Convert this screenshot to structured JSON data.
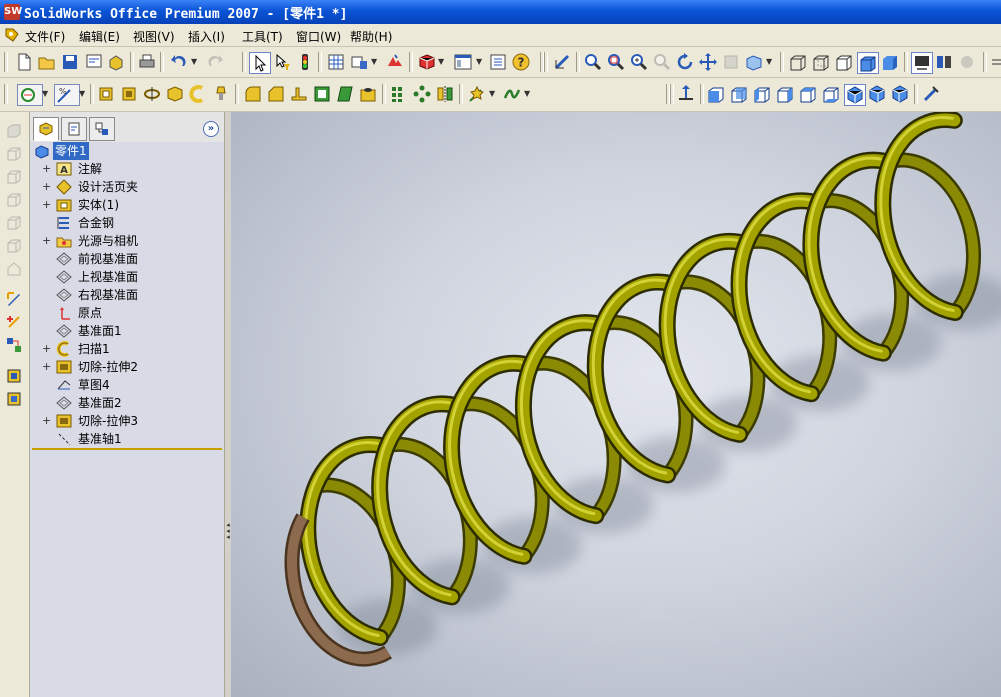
{
  "window": {
    "title": "SolidWorks Office Premium 2007 - [零件1 *]",
    "app_badge": "SW"
  },
  "menu": [
    "文件(F)",
    "编辑(E)",
    "视图(V)",
    "插入(I)",
    "工具(T)",
    "窗口(W)",
    "帮助(H)"
  ],
  "feature_tree": {
    "root": "零件1",
    "items": [
      {
        "label": "注解",
        "icon": "annotation-icon",
        "expandable": true
      },
      {
        "label": "设计活页夹",
        "icon": "design-binder-icon",
        "expandable": true
      },
      {
        "label": "实体(1)",
        "icon": "solid-body-icon",
        "expandable": true
      },
      {
        "label": "合金钢",
        "icon": "material-icon",
        "expandable": false
      },
      {
        "label": "光源与相机",
        "icon": "lights-camera-icon",
        "expandable": true
      },
      {
        "label": "前视基准面",
        "icon": "plane-icon",
        "expandable": false
      },
      {
        "label": "上视基准面",
        "icon": "plane-icon",
        "expandable": false
      },
      {
        "label": "右视基准面",
        "icon": "plane-icon",
        "expandable": false
      },
      {
        "label": "原点",
        "icon": "origin-icon",
        "expandable": false
      },
      {
        "label": "基准面1",
        "icon": "plane-icon",
        "expandable": false
      },
      {
        "label": "扫描1",
        "icon": "sweep-icon",
        "expandable": true
      },
      {
        "label": "切除-拉伸2",
        "icon": "cut-extrude-icon",
        "expandable": true
      },
      {
        "label": "草图4",
        "icon": "sketch-icon",
        "expandable": false
      },
      {
        "label": "基准面2",
        "icon": "plane-icon",
        "expandable": false
      },
      {
        "label": "切除-拉伸3",
        "icon": "cut-extrude-icon",
        "expandable": true
      },
      {
        "label": "基准轴1",
        "icon": "axis-icon",
        "expandable": false
      }
    ]
  },
  "colors": {
    "spring": "#a3a300",
    "spring_cut": "#8c6a4e",
    "selection": "#316ac5"
  }
}
